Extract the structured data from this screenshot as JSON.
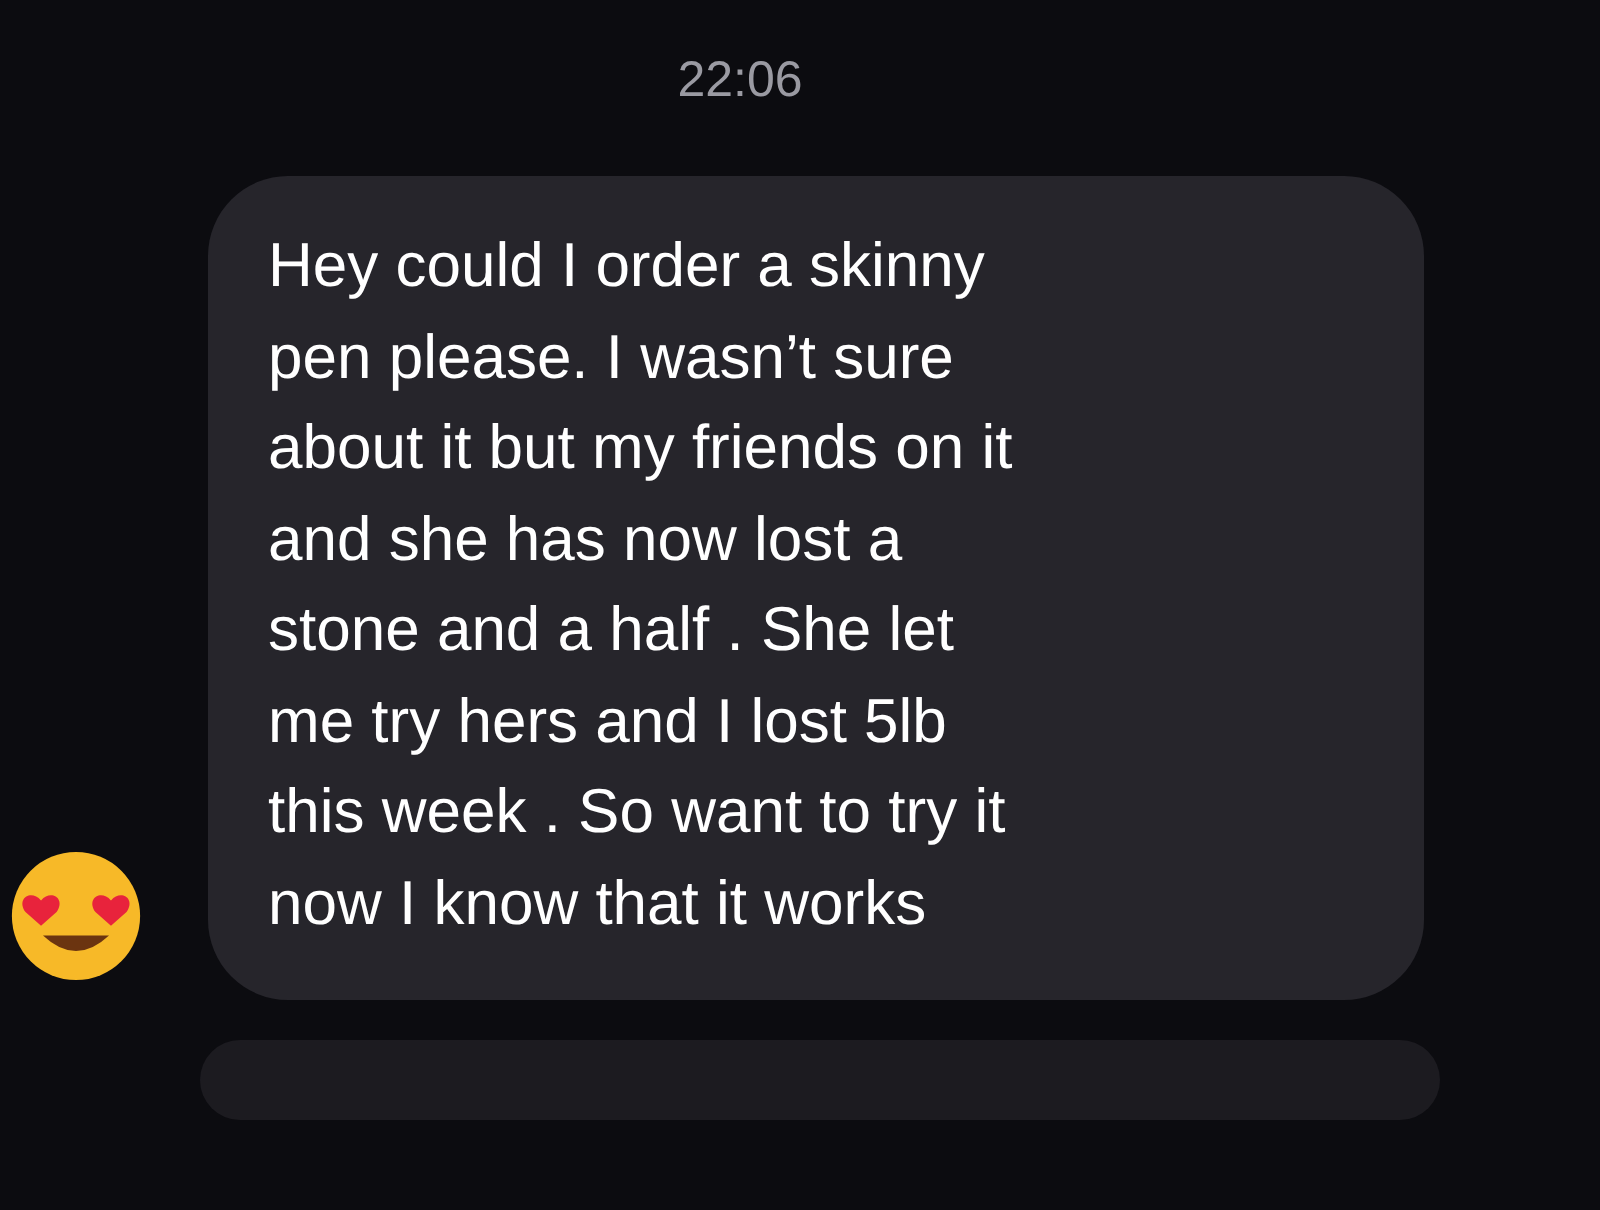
{
  "timestamp": "22:06",
  "message": {
    "lines": [
      "Hey could I order a skinny",
      "pen please. I wasn’t sure",
      "about it but my friends on it",
      "and she has now lost a",
      "stone and a half . She let",
      "me try hers and I lost 5lb",
      "this week . So want to try it",
      "now I know that it works"
    ]
  }
}
